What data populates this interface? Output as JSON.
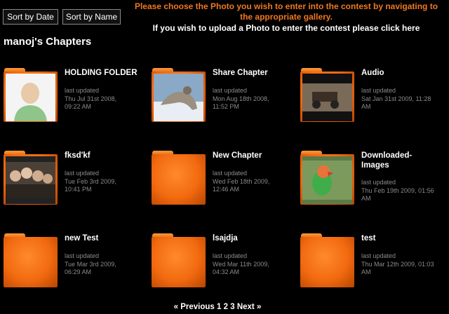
{
  "sort": {
    "date_label": "Sort by Date",
    "name_label": "Sort by Name"
  },
  "notice": {
    "line1": "Please choose the Photo you wish to enter into the contest by navigating to",
    "line2": "the appropriate gallery.",
    "upload_text": "If you wish to upload a Photo to enter the contest please ",
    "upload_link": "click here"
  },
  "page_title": "manoj's Chapters",
  "chapters": [
    {
      "title": "HOLDING FOLDER",
      "meta_label": "last updated",
      "date1": "Thu Jul 31st 2008,",
      "date2": "09:22 AM",
      "thumb": "avatar-placeholder"
    },
    {
      "title": "Share Chapter",
      "meta_label": "last updated",
      "date1": "Mon Aug 18th 2008,",
      "date2": "11:52 PM",
      "thumb": "wolf-in-snow"
    },
    {
      "title": "Audio",
      "meta_label": "last updated",
      "date1": "Sat Jan 31st 2009, 11:28",
      "date2": "AM",
      "thumb": "vehicle-sepia"
    },
    {
      "title": "fksd'kf",
      "meta_label": "last updated",
      "date1": "Tue Feb 3rd 2009,",
      "date2": "10:41 PM",
      "thumb": "group-of-people"
    },
    {
      "title": "New Chapter",
      "meta_label": "last updated",
      "date1": "Wed Feb 18th 2009,",
      "date2": "12:46 AM",
      "thumb": ""
    },
    {
      "title": "Downloaded-",
      "title2": "Images",
      "meta_label": "last updated",
      "date1": "Thu Feb 19th 2009, 01:56",
      "date2": "AM",
      "thumb": "parrot"
    },
    {
      "title": "new Test",
      "meta_label": "last updated",
      "date1": "Tue Mar 3rd 2009,",
      "date2": "06:29 AM",
      "thumb": ""
    },
    {
      "title": "lsajdja",
      "meta_label": "last updated",
      "date1": "Wed Mar 11th 2009,",
      "date2": "04:32 AM",
      "thumb": ""
    },
    {
      "title": "test",
      "meta_label": "last updated",
      "date1": "Thu Mar 12th 2009, 01:03",
      "date2": "AM",
      "thumb": ""
    }
  ],
  "pagination": {
    "prev": "« Previous",
    "pages": [
      "1",
      "2",
      "3"
    ],
    "next": "Next »"
  },
  "colors": {
    "accent": "#f07820",
    "folder": "#f26a10",
    "background": "#000000",
    "meta": "#8a8a8a"
  }
}
